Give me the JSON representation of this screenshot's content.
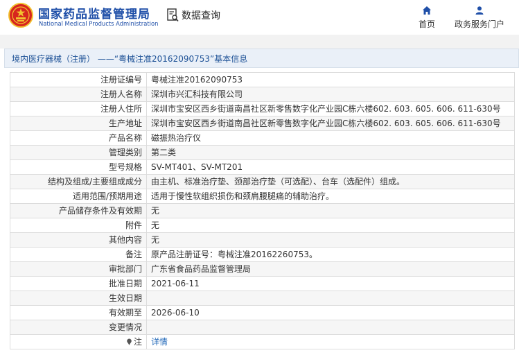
{
  "header": {
    "brand_cn": "国家药品监督管理局",
    "brand_en": "National Medical Products Administration",
    "query_label": "数据查询",
    "nav": [
      {
        "label": "首页",
        "icon": "home-icon"
      },
      {
        "label": "政务服务门户",
        "icon": "user-icon"
      }
    ]
  },
  "title": "境内医疗器械（注册） ——“粤械注准20162090753”基本信息",
  "rows": [
    {
      "label": "注册证编号",
      "value": "粤械注准20162090753"
    },
    {
      "label": "注册人名称",
      "value": "深圳市兴汇科技有限公司"
    },
    {
      "label": "注册人住所",
      "value": "深圳市宝安区西乡街道南昌社区新零售数字化产业园C栋六楼602. 603. 605. 606. 611-630号"
    },
    {
      "label": "生产地址",
      "value": "深圳市宝安区西乡街道南昌社区新零售数字化产业园C栋六楼602. 603. 605. 606. 611-630号"
    },
    {
      "label": "产品名称",
      "value": "磁振热治疗仪"
    },
    {
      "label": "管理类别",
      "value": "第二类"
    },
    {
      "label": "型号规格",
      "value": "SV-MT401、SV-MT201"
    },
    {
      "label": "结构及组成/主要组成成分",
      "value": "由主机、标准治疗垫、颈部治疗垫（可选配）、台车（选配件）组成。"
    },
    {
      "label": "适用范围/预期用途",
      "value": "适用于慢性软组织损伤和颈肩腰腿痛的辅助治疗。"
    },
    {
      "label": "产品储存条件及有效期",
      "value": "无"
    },
    {
      "label": "附件",
      "value": "无"
    },
    {
      "label": "其他内容",
      "value": "无"
    },
    {
      "label": "备注",
      "value": "原产品注册证号：粤械注准20162260753。"
    },
    {
      "label": "审批部门",
      "value": "广东省食品药品监督管理局"
    },
    {
      "label": "批准日期",
      "value": "2021-06-11"
    },
    {
      "label": "生效日期",
      "value": ""
    },
    {
      "label": "有效期至",
      "value": "2026-06-10"
    },
    {
      "label": "变更情况",
      "value": ""
    },
    {
      "label": "注",
      "value": "详情"
    }
  ],
  "colors": {
    "brand_blue": "#1f4fa8",
    "link_blue": "#2a6ebb",
    "emblem_red": "#d7261e",
    "emblem_gold": "#f2c230"
  }
}
